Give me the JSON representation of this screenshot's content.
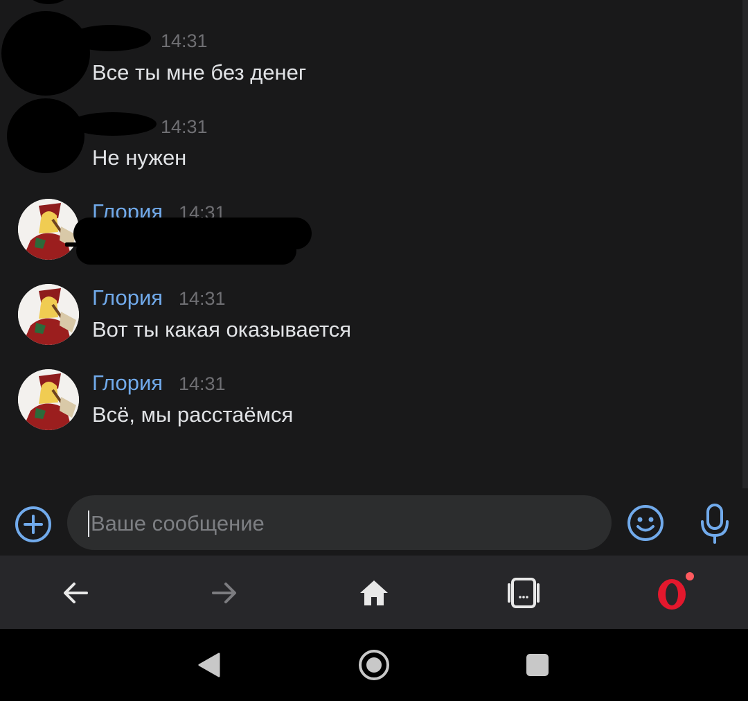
{
  "messages": [
    {
      "author": "",
      "time": "14:31",
      "text": "Все ты мне без денег"
    },
    {
      "author": "",
      "time": "14:31",
      "text": "Не нужен"
    },
    {
      "author": "Глория",
      "time": "14:31",
      "text": ""
    },
    {
      "author": "Глория",
      "time": "14:31",
      "text": "Вот ты какая оказывается"
    },
    {
      "author": "Глория",
      "time": "14:31",
      "text": "Всё, мы расстаёмся"
    }
  ],
  "composer": {
    "placeholder": "Ваше сообщение",
    "value": ""
  },
  "icons": {
    "attach": "plus-circle-icon",
    "emoji": "smile-icon",
    "voice": "microphone-icon",
    "browser_back": "arrow-left-icon",
    "browser_forward": "arrow-right-icon",
    "browser_home": "home-icon",
    "browser_tabs": "tabs-icon",
    "browser_menu": "opera-logo-icon",
    "system_back": "triangle-back-icon",
    "system_home": "circle-home-icon",
    "system_recents": "square-recents-icon"
  },
  "colors": {
    "background": "#19191a",
    "author": "#71aaeb",
    "accent": "#71aaeb",
    "text": "#e1e3e6",
    "time": "#6f6f73",
    "opera_red": "#e3182d"
  }
}
